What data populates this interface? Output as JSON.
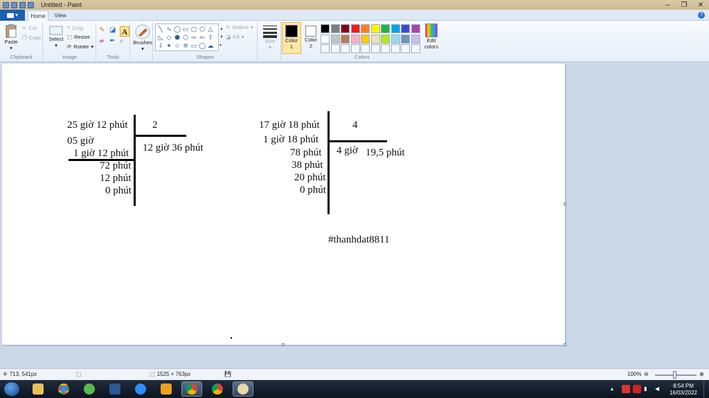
{
  "window": {
    "title": "Untitled - Paint"
  },
  "tabs": {
    "file": "▾",
    "home": "Home",
    "view": "View"
  },
  "clipboard": {
    "paste": "Paste",
    "cut": "Cut",
    "copy": "Copy",
    "label": "Clipboard"
  },
  "image": {
    "select": "Select",
    "crop": "Crop",
    "resize": "Resize",
    "rotate": "Rotate",
    "label": "Image"
  },
  "tools": {
    "label": "Tools",
    "text_glyph": "A"
  },
  "brushes": {
    "label": "Brushes"
  },
  "shapes": {
    "outline": "Outline",
    "fill": "Fill",
    "label": "Shapes"
  },
  "size": {
    "label": "Size"
  },
  "colors": {
    "color1_label": "Color 1",
    "color2_label": "Color 2",
    "edit_label": "Edit colors",
    "label": "Colors",
    "color1": "#000000",
    "color2": "#ffffff",
    "palette_row1": [
      "#000000",
      "#7f7f7f",
      "#880015",
      "#ed1c24",
      "#ff7f27",
      "#fff200",
      "#22b14c",
      "#00a2e8",
      "#3f48cc",
      "#a349a4"
    ],
    "palette_row2": [
      "#ffffff",
      "#c3c3c3",
      "#b97a57",
      "#ffaec9",
      "#ffc90e",
      "#efe4b0",
      "#b5e61d",
      "#99d9ea",
      "#7092be",
      "#c8bfe7"
    ]
  },
  "canvas_content": {
    "left": {
      "dividend": "25 giờ 12 phút",
      "divisor": "2",
      "quotient": "12 giờ 36 phút",
      "rem1": "05 giờ",
      "sub1": "1 giờ 12 phút",
      "s1": "72 phút",
      "s2": "12 phút",
      "s3": "0 phút"
    },
    "right": {
      "dividend": "17 giờ 18 phút",
      "divisor": "4",
      "q1": "4 giờ",
      "q2": "19,5 phút",
      "r1": "1 giờ 18 phút",
      "r2": "78 phút",
      "r3": "38 phút",
      "r4": "20 phút",
      "r5": "0 phút"
    },
    "signature": "#thanhdat8811"
  },
  "status": {
    "cursor": "713, 541px",
    "size": "1525 × 763px",
    "zoom": "100%"
  },
  "taskbar": {
    "time": "8:54 PM",
    "date": "16/03/2022"
  }
}
